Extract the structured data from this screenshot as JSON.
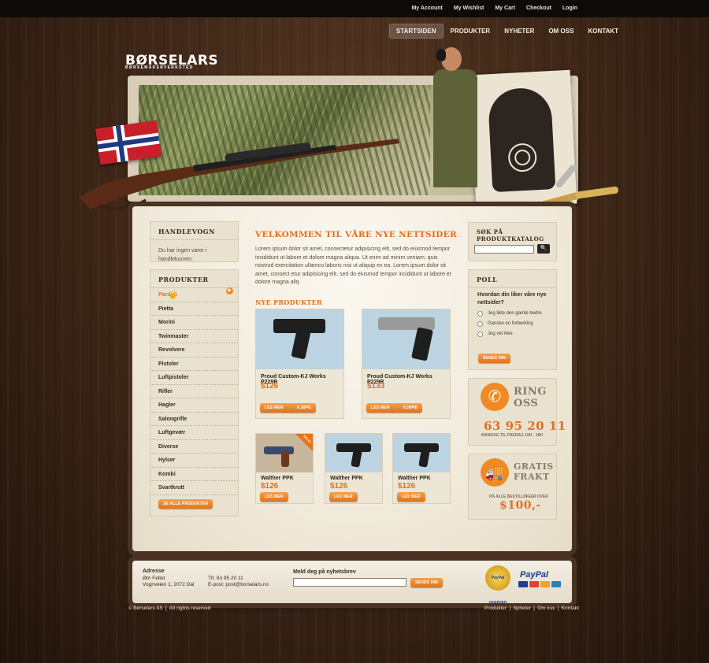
{
  "top_links": [
    "My Account",
    "My Wishlist",
    "My Cart",
    "Checkout",
    "Login"
  ],
  "nav": {
    "items": [
      "STARTSIDEN",
      "PRODUKTER",
      "NYHETER",
      "OM OSS",
      "KONTAKT"
    ],
    "active": "STARTSIDEN"
  },
  "logo": {
    "name": "BØRSELARS",
    "tagline": "BØRSEMAKERVERKSTED"
  },
  "cart": {
    "title": "HANDLEVOGN",
    "text": "Du har ingen varer i handlekurven."
  },
  "categories": {
    "title": "PRODUKTER",
    "items": [
      "Pardini",
      "Pietta",
      "Morini",
      "Twinmaster",
      "Revolvere",
      "Pistoler",
      "Luftpistoler",
      "Rifler",
      "Hagler",
      "Salongrifle",
      "Luftgevær",
      "Diverse",
      "Hylser",
      "Kombi",
      "Svartkrutt"
    ],
    "active": "Pardini",
    "see_all": "SE ALLE PRODUKTER"
  },
  "welcome": {
    "title": "VELKOMMEN TIL VÅRE NYE NETTSIDER",
    "text": "Lorem ipsum dolor sit amet, consectetur adipisicing elit, sed do eiusmod tempor incididunt ut labore et dolore magna aliqua. Ut enim ad minim veniam, quis nostrud exercitation ullamco laboris nisi ut aliquip ex ea. Lorem ipsum dolor sit amet, consect etur adipisicing elit, sed do eiusmod tempor incididunt ut labore et dolore magna aliq"
  },
  "new_products": {
    "title": "NYE PRODUKTER",
    "read_more": "LES MER",
    "buy": "KJØPE",
    "large": [
      {
        "name": "Proud Custom-KJ Works P229R",
        "price": "$126"
      },
      {
        "name": "Proud Custom-KJ Works P229R",
        "price": "$133"
      }
    ],
    "small": [
      {
        "name": "Walther PPK",
        "price": "$126",
        "sale": "SALG!"
      },
      {
        "name": "Walther PPK",
        "price": "$126",
        "sale": ""
      },
      {
        "name": "Walther PPK",
        "price": "$126",
        "sale": ""
      }
    ]
  },
  "search": {
    "title": "SØK PÅ PRODUKTKATALOG",
    "button": "🔍"
  },
  "poll": {
    "title": "POLL",
    "question": "Hvordan din liker våre nye nettsider?",
    "options": [
      "Jeg likte den gamle bedre",
      "Ganske en forbedring",
      "Jeg vet ikke"
    ],
    "submit": "SENDE INN"
  },
  "call": {
    "title_1": "RING",
    "title_2": "OSS",
    "number": "63 95 20 11",
    "hours": "MANDAG TIL FREDAG 10H - 18H"
  },
  "shipping": {
    "title_1": "GRATIS",
    "title_2": "FRAKT",
    "text": "PÅ ALLE BESTILLINGER OVER",
    "amount": "$100,-"
  },
  "footer": {
    "address_label": "Adresse",
    "address_1": "Øm Feltet",
    "address_2": "Vognveien 1, 2072 Dal",
    "phone": "Tlf. 63 95 20 11",
    "email": "E-post: post@borselars.no",
    "newsletter_label": "Meld deg på nyhetsbrev",
    "newsletter_button": "SENDE INN",
    "paypal_seal": "PayPal VERIFIED",
    "paypal": "PayPal"
  },
  "copyright": "© Børselars AS",
  "rights": "All rights reserved",
  "footer_links": [
    "Produkter",
    "Nyheter",
    "Om oss",
    "Kontakt"
  ],
  "colors": {
    "accent": "#e07020",
    "dark": "#0e0a07",
    "wood": "#3a2416"
  }
}
